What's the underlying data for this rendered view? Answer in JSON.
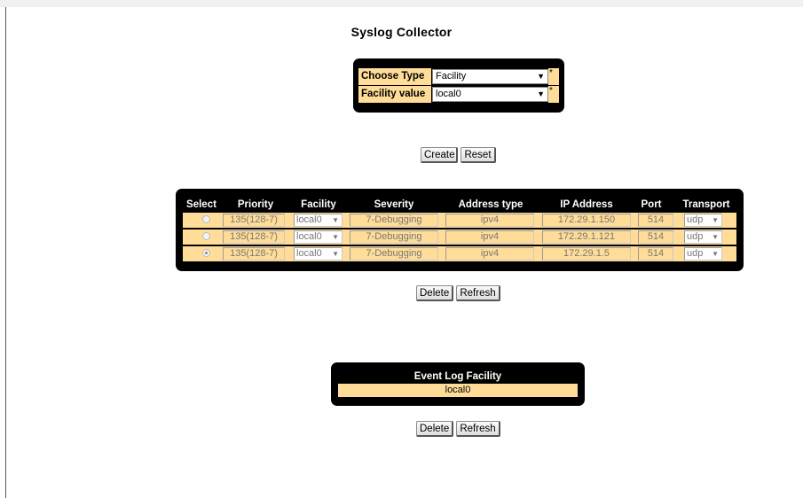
{
  "page": {
    "title": "Syslog Collector"
  },
  "form": {
    "choose_type_label": "Choose Type",
    "choose_type_value": "Facility",
    "facility_value_label": "Facility value",
    "facility_value_value": "local0",
    "required_mark": "*",
    "dropdown_arrow": "▼"
  },
  "form_actions": {
    "create_label": "Create",
    "reset_label": "Reset"
  },
  "table": {
    "headers": [
      "Select",
      "Priority",
      "Facility",
      "Severity",
      "Address type",
      "IP Address",
      "Port",
      "Transport"
    ],
    "rows": [
      {
        "selected": false,
        "priority": "135(128-7)",
        "facility": "local0",
        "severity": "7-Debugging",
        "address_type": "ipv4",
        "ip_address": "172.29.1.150",
        "port": "514",
        "transport": "udp"
      },
      {
        "selected": false,
        "priority": "135(128-7)",
        "facility": "local0",
        "severity": "7-Debugging",
        "address_type": "ipv4",
        "ip_address": "172.29.1.121",
        "port": "514",
        "transport": "udp"
      },
      {
        "selected": true,
        "priority": "135(128-7)",
        "facility": "local0",
        "severity": "7-Debugging",
        "address_type": "ipv4",
        "ip_address": "172.29.1.5",
        "port": "514",
        "transport": "udp"
      }
    ]
  },
  "table_actions": {
    "delete_label": "Delete",
    "refresh_label": "Refresh"
  },
  "event_log": {
    "header": "Event Log Facility",
    "value": "local0"
  },
  "event_actions": {
    "delete_label": "Delete",
    "refresh_label": "Refresh"
  },
  "colors": {
    "panel": "#000000",
    "field_bg": "#ffdd99",
    "page_bg": "#ffffff"
  }
}
